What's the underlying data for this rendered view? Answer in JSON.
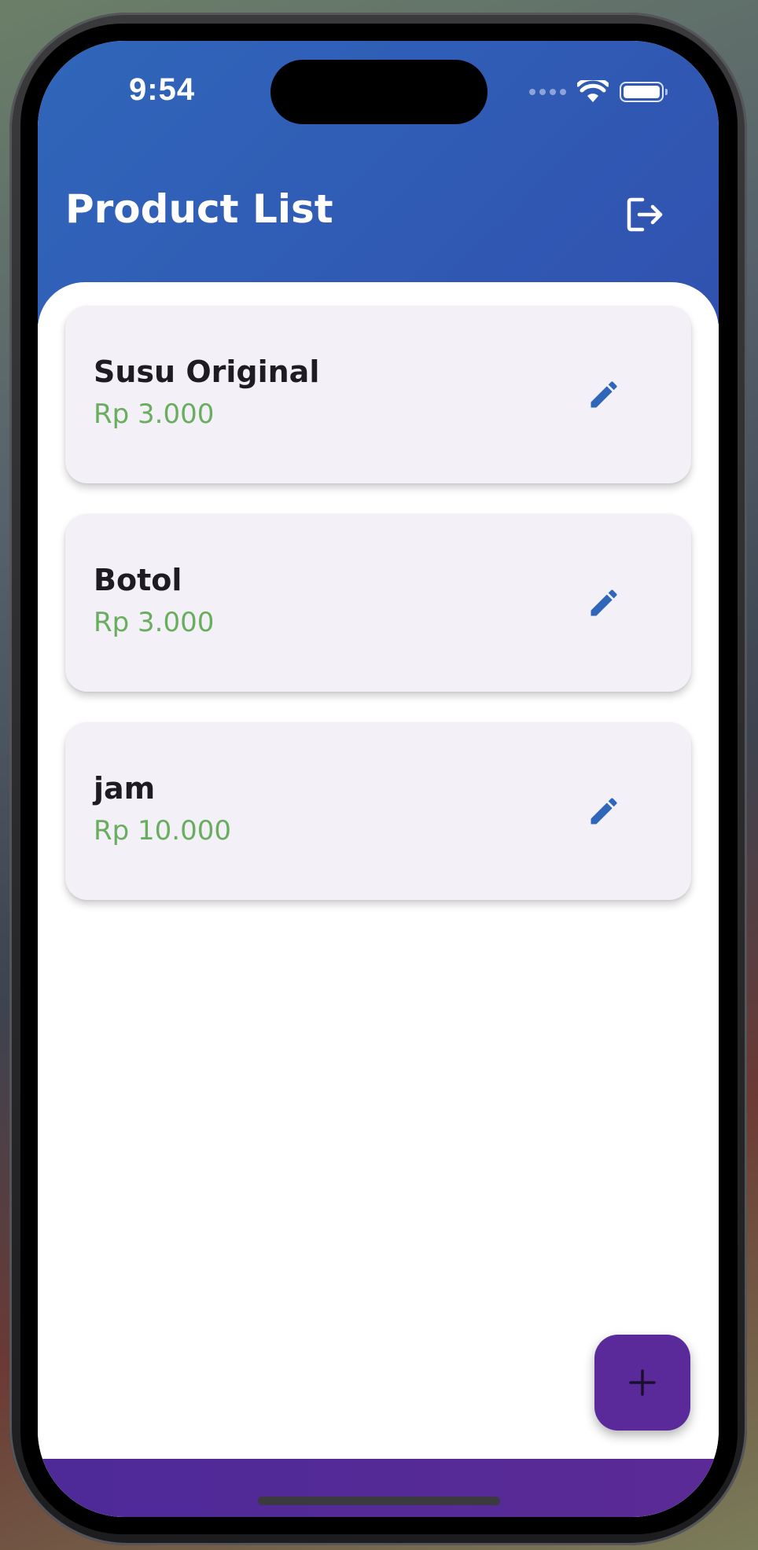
{
  "status_bar": {
    "time": "9:54",
    "icons": [
      "cellular-dots-icon",
      "wifi-icon",
      "battery-icon"
    ]
  },
  "header": {
    "title": "Product List",
    "logout_icon": "logout-icon"
  },
  "products": [
    {
      "name": "Susu Original",
      "price": "Rp 3.000",
      "action_icon": "pencil-edit-icon"
    },
    {
      "name": "Botol",
      "price": "Rp 3.000",
      "action_icon": "pencil-edit-icon"
    },
    {
      "name": "jam",
      "price": "Rp 10.000",
      "action_icon": "pencil-edit-icon"
    }
  ],
  "fab": {
    "icon": "plus-icon"
  },
  "colors": {
    "header_gradient_start": "#2f66ba",
    "header_gradient_end": "#3152b0",
    "card_background": "#f3f0f7",
    "price_text": "#68ae5e",
    "edit_icon": "#2f66ba",
    "fab_background": "#5a2a9a",
    "bottom_bar": "#5b2a96"
  }
}
